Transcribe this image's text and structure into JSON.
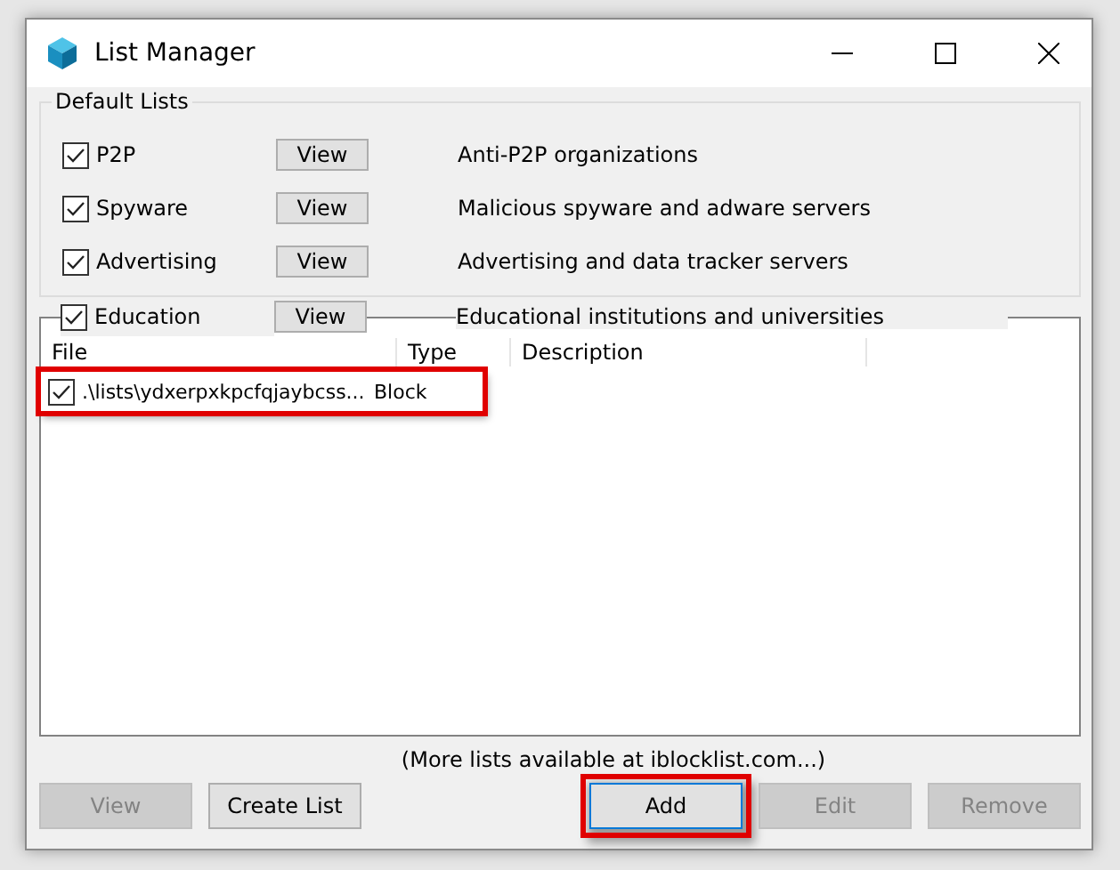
{
  "window": {
    "title": "List Manager"
  },
  "default_lists": {
    "title": "Default Lists",
    "items": [
      {
        "label": "P2P",
        "checked": true,
        "button": "View",
        "description": "Anti-P2P organizations"
      },
      {
        "label": "Spyware",
        "checked": true,
        "button": "View",
        "description": "Malicious spyware and adware servers"
      },
      {
        "label": "Advertising",
        "checked": true,
        "button": "View",
        "description": "Advertising and data tracker servers"
      },
      {
        "label": "Education",
        "checked": true,
        "button": "View",
        "description": "Educational institutions and universities"
      }
    ]
  },
  "list": {
    "columns": [
      "File",
      "Type",
      "Description"
    ],
    "rows": [
      {
        "checked": true,
        "file": ".\\lists\\ydxerpxkpcfqjaybcss...",
        "type": "Block",
        "highlighted": true
      }
    ]
  },
  "footer_link": "(More lists available at iblocklist.com...)",
  "buttons": [
    {
      "label": "View",
      "disabled": true,
      "focused": false,
      "highlighted": false
    },
    {
      "label": "Create List",
      "disabled": false,
      "focused": false,
      "highlighted": false
    },
    {
      "label": "Add",
      "disabled": false,
      "focused": true,
      "highlighted": true
    },
    {
      "label": "Edit",
      "disabled": true,
      "focused": false,
      "highlighted": false
    },
    {
      "label": "Remove",
      "disabled": true,
      "focused": false,
      "highlighted": false
    }
  ]
}
